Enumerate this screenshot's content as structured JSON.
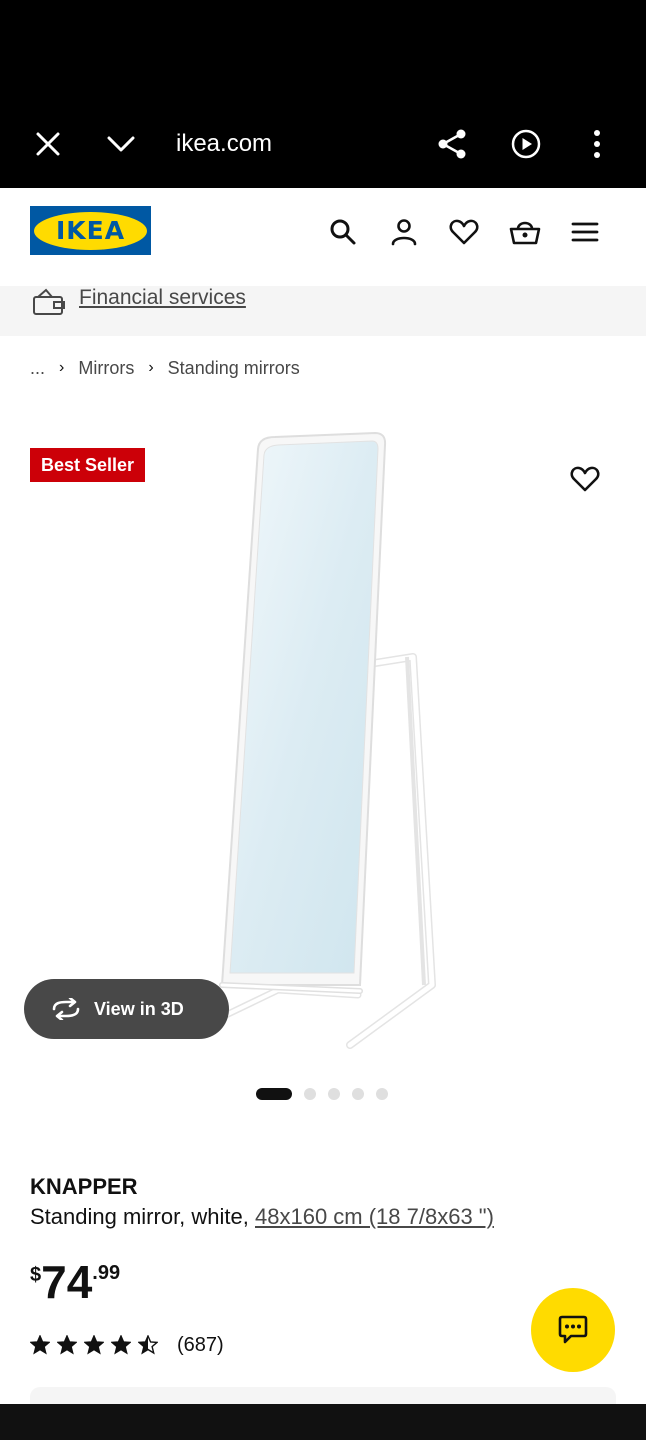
{
  "browser": {
    "url": "ikea.com",
    "icons": [
      "close-icon",
      "chevron-down-icon",
      "share-icon",
      "play-circle-icon",
      "more-vert-icon"
    ]
  },
  "header": {
    "logo_text": "IKEA",
    "icons": [
      "search-icon",
      "user-icon",
      "heart-icon",
      "basket-icon",
      "menu-icon"
    ],
    "colors": {
      "logo_blue": "#0058a3",
      "logo_yellow": "#ffdb00"
    }
  },
  "financial": {
    "link_text": "Financial services"
  },
  "breadcrumb": {
    "ellipsis": "...",
    "items": [
      "Mirrors",
      "Standing mirrors"
    ]
  },
  "product": {
    "badge": "Best Seller",
    "view3d_label": "View in 3D",
    "carousel": {
      "total": 5,
      "active": 1
    },
    "name": "KNAPPER",
    "description": "Standing mirror, white,",
    "size": "48x160 cm (18 7/8x63 \")",
    "price": {
      "currency": "$",
      "integer": "74",
      "decimal": ".99"
    },
    "rating": {
      "stars": 4.5,
      "count": "(687)"
    },
    "colors": {
      "badge": "#cc0008"
    }
  },
  "chat": {
    "icon": "chat-icon",
    "color": "#ffdb00"
  }
}
